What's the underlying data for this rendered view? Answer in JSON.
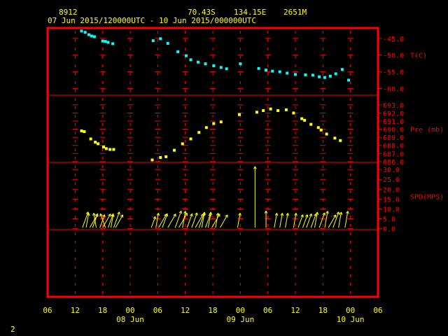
{
  "header": {
    "station_id": "8912",
    "latitude": "70.43S",
    "longitude": "134.15E",
    "elevation": "2651M",
    "time_range": "07 Jun 2015/120000UTC - 10 Jun 2015/000000UTC"
  },
  "footer": {
    "page_number": "2"
  },
  "colors": {
    "frame": "#ff0000",
    "temperature": "#00ffff",
    "pressure": "#ffff00",
    "wind": "#ffff00",
    "axis_text": "#ffff00",
    "panel_text": "#ff0000",
    "background": "#000000"
  },
  "chart_data": {
    "type": "scatter",
    "x_unit": "hours since 07 Jun 2015 06 UTC",
    "x_range": [
      0,
      72
    ],
    "x_tick_labels": [
      "06",
      "12",
      "18",
      "00",
      "06",
      "12",
      "18",
      "00",
      "06",
      "12",
      "18",
      "00",
      "06"
    ],
    "x_date_labels": [
      {
        "label": "08 Jun",
        "hour": 18
      },
      {
        "label": "09 Jun",
        "hour": 42
      },
      {
        "label": "10 Jun",
        "hour": 66
      }
    ],
    "panels": [
      {
        "name": "temperature",
        "label": "T(C)",
        "tick_labels": [
          "-45.0",
          "-50.0",
          "-55.0",
          "-60.0"
        ],
        "tick_values": [
          -45,
          -50,
          -55,
          -60
        ],
        "range": [
          -62,
          -41.9
        ],
        "points": [
          [
            7.4,
            -42.8
          ],
          [
            8.2,
            -43.2
          ],
          [
            9.0,
            -43.9
          ],
          [
            9.6,
            -44.3
          ],
          [
            10.2,
            -44.5
          ],
          [
            12.0,
            -45.8
          ],
          [
            12.6,
            -45.9
          ],
          [
            13.2,
            -46.2
          ],
          [
            14.2,
            -46.6
          ],
          [
            23.0,
            -45.7
          ],
          [
            24.6,
            -45.1
          ],
          [
            26.2,
            -46.5
          ],
          [
            28.4,
            -49.0
          ],
          [
            30.2,
            -50.2
          ],
          [
            31.2,
            -51.4
          ],
          [
            32.8,
            -52.1
          ],
          [
            34.4,
            -52.6
          ],
          [
            36.2,
            -53.2
          ],
          [
            37.8,
            -53.7
          ],
          [
            39.0,
            -54.1
          ],
          [
            42.0,
            -52.6
          ],
          [
            46.0,
            -54.0
          ],
          [
            47.6,
            -54.5
          ],
          [
            49.0,
            -54.8
          ],
          [
            50.6,
            -55.0
          ],
          [
            52.2,
            -55.4
          ],
          [
            54.0,
            -55.8
          ],
          [
            56.2,
            -55.9
          ],
          [
            57.8,
            -56.0
          ],
          [
            59.2,
            -56.5
          ],
          [
            60.4,
            -56.7
          ],
          [
            61.6,
            -56.3
          ],
          [
            62.8,
            -55.6
          ],
          [
            64.2,
            -54.3
          ],
          [
            65.6,
            -57.5
          ]
        ]
      },
      {
        "name": "pressure",
        "label": "Pre (mb)",
        "tick_labels": [
          "693.0",
          "692.0",
          "691.0",
          "690.0",
          "689.0",
          "688.0",
          "687.0",
          "686.0"
        ],
        "tick_values": [
          693,
          692,
          691,
          690,
          689,
          688,
          687,
          686
        ],
        "range": [
          685.9,
          694.2
        ],
        "points": [
          [
            7.4,
            689.8
          ],
          [
            8.0,
            689.7
          ],
          [
            9.4,
            688.8
          ],
          [
            10.4,
            688.4
          ],
          [
            11.0,
            688.2
          ],
          [
            12.2,
            687.8
          ],
          [
            12.8,
            687.6
          ],
          [
            13.6,
            687.5
          ],
          [
            14.4,
            687.5
          ],
          [
            22.8,
            686.2
          ],
          [
            24.6,
            686.5
          ],
          [
            25.8,
            686.6
          ],
          [
            27.6,
            687.4
          ],
          [
            29.4,
            688.2
          ],
          [
            31.2,
            688.8
          ],
          [
            33.0,
            689.6
          ],
          [
            34.6,
            690.2
          ],
          [
            36.2,
            690.7
          ],
          [
            37.8,
            690.9
          ],
          [
            41.8,
            691.8
          ],
          [
            45.6,
            692.1
          ],
          [
            47.0,
            692.3
          ],
          [
            48.6,
            692.5
          ],
          [
            50.2,
            692.3
          ],
          [
            52.0,
            692.4
          ],
          [
            53.6,
            692.0
          ],
          [
            55.4,
            691.3
          ],
          [
            56.0,
            691.1
          ],
          [
            57.4,
            690.6
          ],
          [
            59.0,
            690.2
          ],
          [
            59.6,
            689.9
          ],
          [
            60.8,
            689.4
          ],
          [
            62.6,
            688.9
          ],
          [
            63.8,
            688.6
          ]
        ]
      },
      {
        "name": "wind",
        "label": "SPD(MPS)",
        "tick_labels": [
          "30.0",
          "25.0",
          "20.0",
          "15.0",
          "10.0",
          "5.0",
          "0.0"
        ],
        "tick_values": [
          30,
          25,
          20,
          15,
          10,
          5,
          0
        ],
        "range": [
          -0.5,
          33.6
        ],
        "points": [
          [
            7.6,
            8.5,
            20
          ],
          [
            8.4,
            7.5,
            10
          ],
          [
            9.2,
            8.0,
            30
          ],
          [
            9.8,
            7.5,
            20
          ],
          [
            10.6,
            7.5,
            -10
          ],
          [
            11.4,
            7.0,
            20
          ],
          [
            12.0,
            8.0,
            30
          ],
          [
            12.6,
            7.5,
            -20
          ],
          [
            13.2,
            7.5,
            20
          ],
          [
            13.8,
            7.0,
            10
          ],
          [
            14.4,
            8.5,
            20
          ],
          [
            14.8,
            7.5,
            30
          ],
          [
            22.6,
            6.0,
            20
          ],
          [
            23.6,
            7.5,
            10
          ],
          [
            24.2,
            8.0,
            30
          ],
          [
            25.0,
            7.5,
            20
          ],
          [
            26.2,
            8.0,
            30
          ],
          [
            27.8,
            9.0,
            20
          ],
          [
            28.6,
            8.5,
            30
          ],
          [
            29.4,
            8.5,
            10
          ],
          [
            30.4,
            7.5,
            20
          ],
          [
            31.4,
            8.0,
            20
          ],
          [
            32.2,
            8.0,
            30
          ],
          [
            33.0,
            8.0,
            20
          ],
          [
            33.6,
            8.0,
            10
          ],
          [
            34.4,
            7.5,
            20
          ],
          [
            35.0,
            8.0,
            10
          ],
          [
            35.8,
            8.0,
            30
          ],
          [
            36.6,
            7.5,
            10
          ],
          [
            37.6,
            7.5,
            30
          ],
          [
            41.4,
            7.5,
            10
          ],
          [
            45.2,
            31.0,
            0
          ],
          [
            47.6,
            8.5,
            0
          ],
          [
            49.4,
            7.5,
            10
          ],
          [
            50.6,
            7.5,
            10
          ],
          [
            51.8,
            7.5,
            10
          ],
          [
            53.6,
            7.5,
            10
          ],
          [
            54.6,
            7.0,
            20
          ],
          [
            55.6,
            7.0,
            20
          ],
          [
            56.4,
            7.5,
            20
          ],
          [
            57.4,
            7.5,
            20
          ],
          [
            58.2,
            8.0,
            10
          ],
          [
            59.2,
            8.0,
            20
          ],
          [
            60.4,
            8.5,
            10
          ],
          [
            61.2,
            7.5,
            30
          ],
          [
            62.2,
            8.5,
            20
          ],
          [
            63.4,
            8.0,
            10
          ],
          [
            64.8,
            8.5,
            10
          ]
        ]
      },
      {
        "name": "empty",
        "label": "",
        "tick_labels": [],
        "tick_values": [],
        "range": [
          0,
          1
        ],
        "points": []
      }
    ]
  }
}
